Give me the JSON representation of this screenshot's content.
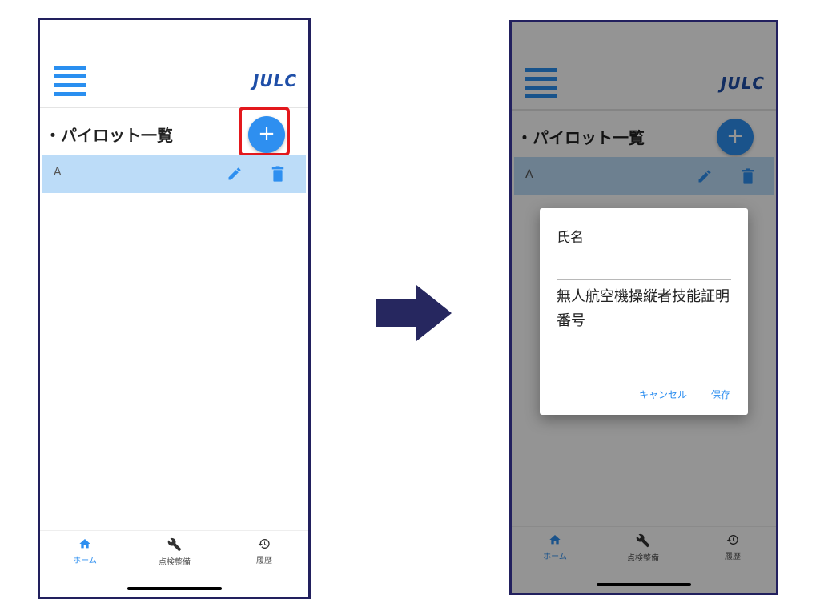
{
  "app": {
    "logo": "JULC"
  },
  "list_screen": {
    "title": "・パイロット一覧",
    "add_button_label": "+",
    "pilots": [
      {
        "name": "A"
      }
    ]
  },
  "bottom_nav": {
    "items": [
      {
        "label": "ホーム",
        "icon": "home-icon",
        "active": true
      },
      {
        "label": "点検整備",
        "icon": "wrench-icon",
        "active": false
      },
      {
        "label": "履歴",
        "icon": "history-icon",
        "active": false
      }
    ]
  },
  "dialog": {
    "name_field": "氏名",
    "license_field": "無人航空機操縦者技能証明番号",
    "cancel_label": "キャンセル",
    "save_label": "保存"
  },
  "colors": {
    "accent": "#2e8ff0",
    "selected_row": "#bcdcf8",
    "frame": "#22205e",
    "highlight": "#e3181d",
    "logo": "#1f4fa8"
  },
  "annotations": {
    "transition_arrow": "arrow-right-icon"
  }
}
